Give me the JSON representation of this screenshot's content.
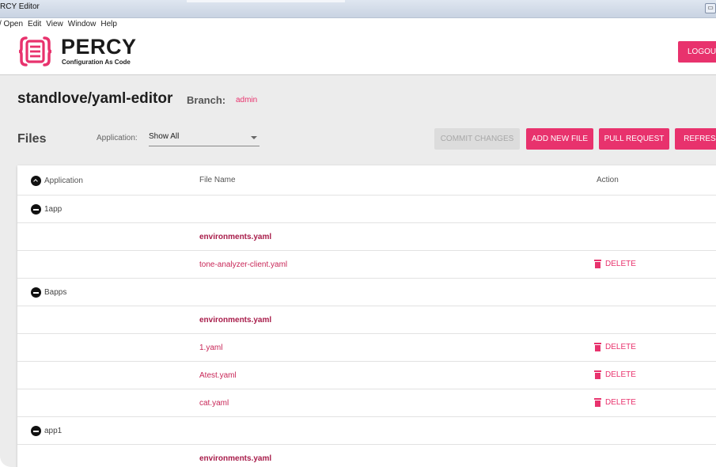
{
  "window": {
    "title": "RCY Editor",
    "menu": [
      "/ Open",
      "Edit",
      "View",
      "Window",
      "Help"
    ],
    "window_button": "▭"
  },
  "header": {
    "brand": "PERCY",
    "tagline": "Configuration As Code",
    "logout_label": "LOGOUT"
  },
  "repo": {
    "name": "standlove/yaml-editor",
    "branch_label": "Branch:",
    "branch_value": "admin"
  },
  "files": {
    "title": "Files",
    "application_label": "Application:",
    "application_selected": "Show All",
    "buttons": {
      "commit": "COMMIT CHANGES",
      "add_file": "ADD NEW FILE",
      "pull_request": "PULL REQUEST",
      "refresh": "REFRESH"
    }
  },
  "table": {
    "columns": {
      "application": "Application",
      "file_name": "File Name",
      "action": "Action"
    },
    "delete_label": "DELETE",
    "groups": [
      {
        "name": "1app",
        "files": [
          {
            "name": "environments.yaml",
            "bold": true,
            "deletable": false
          },
          {
            "name": "tone-analyzer-client.yaml",
            "bold": false,
            "deletable": true
          }
        ]
      },
      {
        "name": "Bapps",
        "files": [
          {
            "name": "environments.yaml",
            "bold": true,
            "deletable": false
          },
          {
            "name": "1.yaml",
            "bold": false,
            "deletable": true
          },
          {
            "name": "Atest.yaml",
            "bold": false,
            "deletable": true
          },
          {
            "name": "cat.yaml",
            "bold": false,
            "deletable": true
          }
        ]
      },
      {
        "name": "app1",
        "files": [
          {
            "name": "environments.yaml",
            "bold": true,
            "deletable": false
          }
        ]
      }
    ]
  },
  "colors": {
    "accent": "#e8326d",
    "file_link": "#c82657",
    "env_file": "#a81c4a",
    "disabled_button": "#dcdcdc"
  }
}
